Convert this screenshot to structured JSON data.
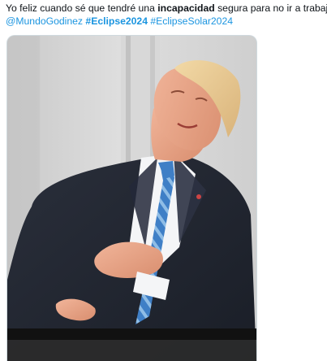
{
  "tweet": {
    "text_prefix": "Yo feliz cuando sé que tendré una ",
    "text_bold": "incapacidad",
    "text_suffix": " segura para no ir a trabajar",
    "mention": "@MundoGodinez",
    "hashtags": [
      "#Eclipse2024",
      "#EclipseSolar2024"
    ]
  },
  "media": {
    "kind": "photo",
    "subject": "man-looking-up-at-sky-photo"
  },
  "colors": {
    "link": "#1b95e0",
    "text": "#0f1419",
    "border": "#cfd9de"
  }
}
